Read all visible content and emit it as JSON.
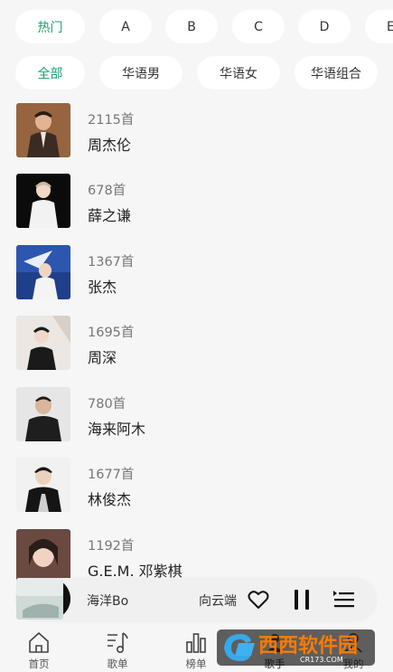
{
  "filters": {
    "letters": [
      "热门",
      "A",
      "B",
      "C",
      "D",
      "E"
    ],
    "categories": [
      "全部",
      "华语男",
      "华语女",
      "华语组合"
    ]
  },
  "singers": [
    {
      "count": "2115首",
      "name": "周杰伦"
    },
    {
      "count": "678首",
      "name": "薛之谦"
    },
    {
      "count": "1367首",
      "name": "张杰"
    },
    {
      "count": "1695首",
      "name": "周深"
    },
    {
      "count": "780首",
      "name": "海来阿木"
    },
    {
      "count": "1677首",
      "name": "林俊杰"
    },
    {
      "count": "1192首",
      "name": "G.E.M. 邓紫棋"
    }
  ],
  "player": {
    "song": "海洋Bo",
    "lyric": "向云端",
    "icons": [
      "heart-icon",
      "pause-icon",
      "playlist-icon"
    ]
  },
  "nav": {
    "items": [
      {
        "label": "首页",
        "icon": "home-icon"
      },
      {
        "label": "歌单",
        "icon": "music-note-icon"
      },
      {
        "label": "榜单",
        "icon": "bar-chart-icon"
      },
      {
        "label": "歌手",
        "icon": "singer-icon"
      },
      {
        "label": "我的",
        "icon": "profile-icon"
      }
    ]
  },
  "watermark": {
    "text": "西西软件园",
    "sub": "CR173.COM"
  },
  "colors": {
    "accent": "#1aa36c",
    "background": "#f6f6f6",
    "pill": "#ffffff"
  }
}
